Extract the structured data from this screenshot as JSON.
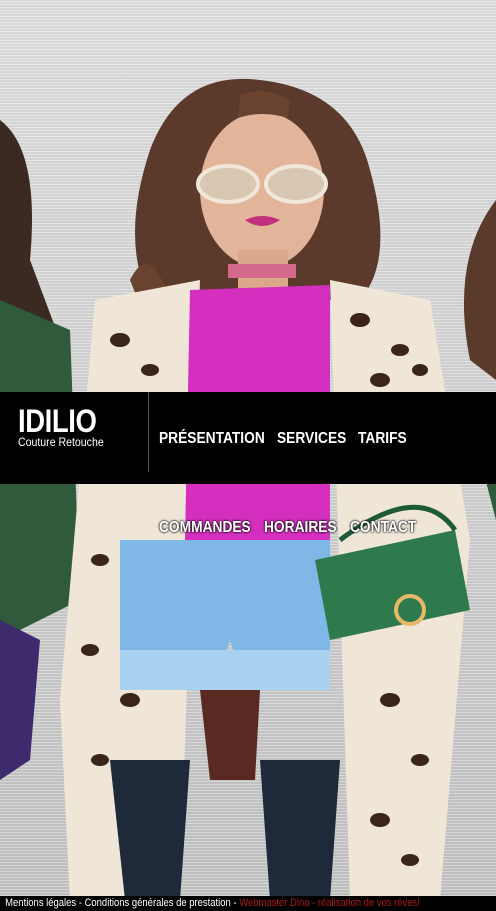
{
  "brand": {
    "name": "IDILIO",
    "tagline": "Couture Retouche"
  },
  "nav": {
    "row1": [
      "PRÉSENTATION",
      "SERVICES",
      "TARIFS"
    ],
    "row2": [
      "COMMANDES",
      "HORAIRES",
      "CONTACT"
    ]
  },
  "footer": {
    "legal": "Mentions légales",
    "sep1": " - ",
    "terms": "Conditions générales de prestation",
    "sep2": " - ",
    "credit": "Webmaster Dina - réalisation de vos rêves!"
  },
  "colors": {
    "header_bg": "#000000",
    "nav_text": "#ffffff",
    "credit": "#b01818"
  }
}
